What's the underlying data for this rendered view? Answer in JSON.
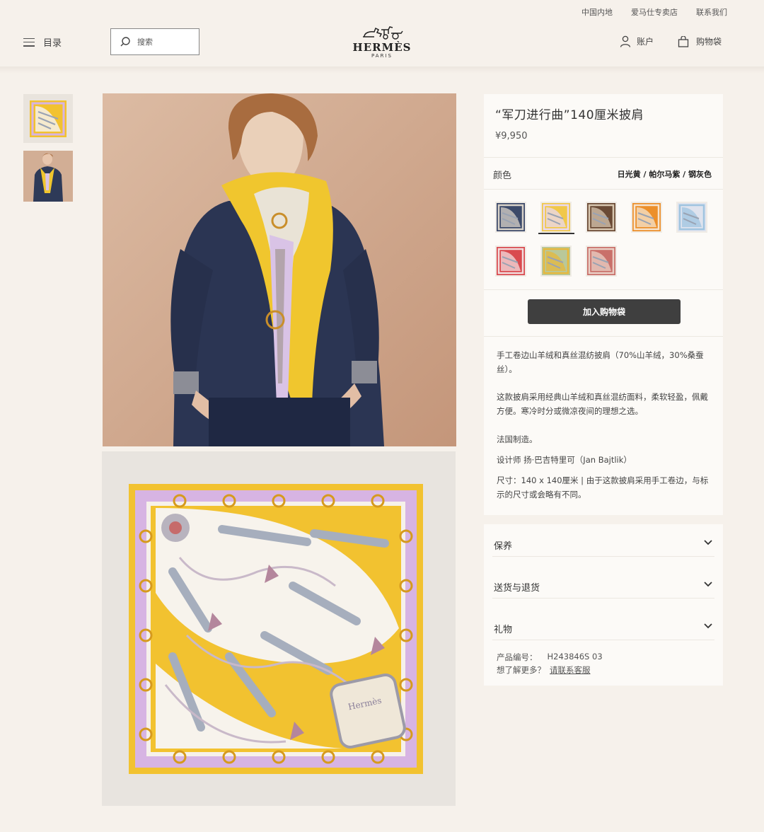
{
  "util_links": [
    "中国内地",
    "爱马仕专卖店",
    "联系我们"
  ],
  "header": {
    "menu_label": "目录",
    "search_placeholder": "搜索",
    "brand": "HERMÈS",
    "brand_city": "PARIS",
    "account_label": "账户",
    "cart_label": "购物袋"
  },
  "product": {
    "title": "“军刀进行曲”140厘米披肩",
    "price": "¥9,950",
    "color_label": "颜色",
    "color_value": "日光黄 / 帕尔马紫 / 钢灰色",
    "add_to_cart": "加入购物袋",
    "swatches": [
      {
        "name": "navy",
        "color": "#3c4a6a",
        "accent": "#d9d3c9"
      },
      {
        "name": "sun-yellow",
        "color": "#f1c84a",
        "accent": "#e9d9f0",
        "selected": true
      },
      {
        "name": "brown",
        "color": "#6a4a35",
        "accent": "#d8c7b0"
      },
      {
        "name": "orange",
        "color": "#ec8f2a",
        "accent": "#f6e4cf"
      },
      {
        "name": "pale-blue",
        "color": "#dfe3ee",
        "accent": "#9fc4e0"
      },
      {
        "name": "red",
        "color": "#d94a4f",
        "accent": "#f2dede"
      },
      {
        "name": "sage",
        "color": "#b9c89a",
        "accent": "#e7b83c"
      },
      {
        "name": "rose",
        "color": "#c9706a",
        "accent": "#ead0c6"
      }
    ],
    "description": [
      "手工卷边山羊绒和真丝混纺披肩（70%山羊绒，30%桑蚕丝）。",
      "这款披肩采用经典山羊绒和真丝混纺面料，柔软轻盈，佩戴方便。寒冷时分或微凉夜间的理想之选。",
      "法国制造。",
      "设计师 扬·巴吉特里可（Jan Bajtlik）",
      "尺寸：140 x 140厘米 | 由于这款披肩采用手工卷边，与标示的尺寸或会略有不同。"
    ]
  },
  "accordion": [
    "保养",
    "送货与退货",
    "礼物"
  ],
  "sku_label": "产品编号：",
  "sku_value": "H243846S 03",
  "help_text": "想了解更多？",
  "help_link": "请联系客服",
  "colors": {
    "background": "#f6f1eb",
    "card": "#fcfaf7",
    "button": "#3f3f3f",
    "scarf_yellow": "#f2c230",
    "scarf_lilac": "#d7b4e3"
  }
}
